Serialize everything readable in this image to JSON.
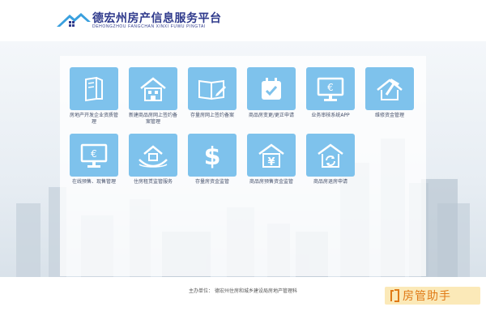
{
  "header": {
    "title": "德宏州房产信息服务平台",
    "subtitle": "DEHONGZHOU FANGCHAN XINXI FUWU PINGTAI"
  },
  "tiles": [
    {
      "label": "房地产开发企业资质管理",
      "icon": "document-book-icon"
    },
    {
      "label": "新建商品房网上签约备案管理",
      "icon": "house-icon"
    },
    {
      "label": "存量房网上签约备案",
      "icon": "open-book-pen-icon"
    },
    {
      "label": "商品房变更/更正申请",
      "icon": "calendar-check-icon"
    },
    {
      "label": "业务审核系统APP",
      "icon": "monitor-euro-icon"
    },
    {
      "label": "维修资金管理",
      "icon": "house-hammer-icon"
    },
    {
      "label": "在线预售、现售管理",
      "icon": "monitor-euro-icon"
    },
    {
      "label": "住房租赁监管服务",
      "icon": "house-hands-icon"
    },
    {
      "label": "存量房资金监管",
      "icon": "dollar-icon"
    },
    {
      "label": "商品房预售资金监管",
      "icon": "house-yuan-icon"
    },
    {
      "label": "商品房退房申请",
      "icon": "house-refresh-icon"
    }
  ],
  "footer": {
    "text": "主办单位：  德宏州住房和城乡建设局房地产管理科"
  },
  "watermark": {
    "text": "房管助手"
  },
  "colors": {
    "tile": "#7ec2ec",
    "brand": "#2f3a8c",
    "logo": "#3aa0de"
  }
}
